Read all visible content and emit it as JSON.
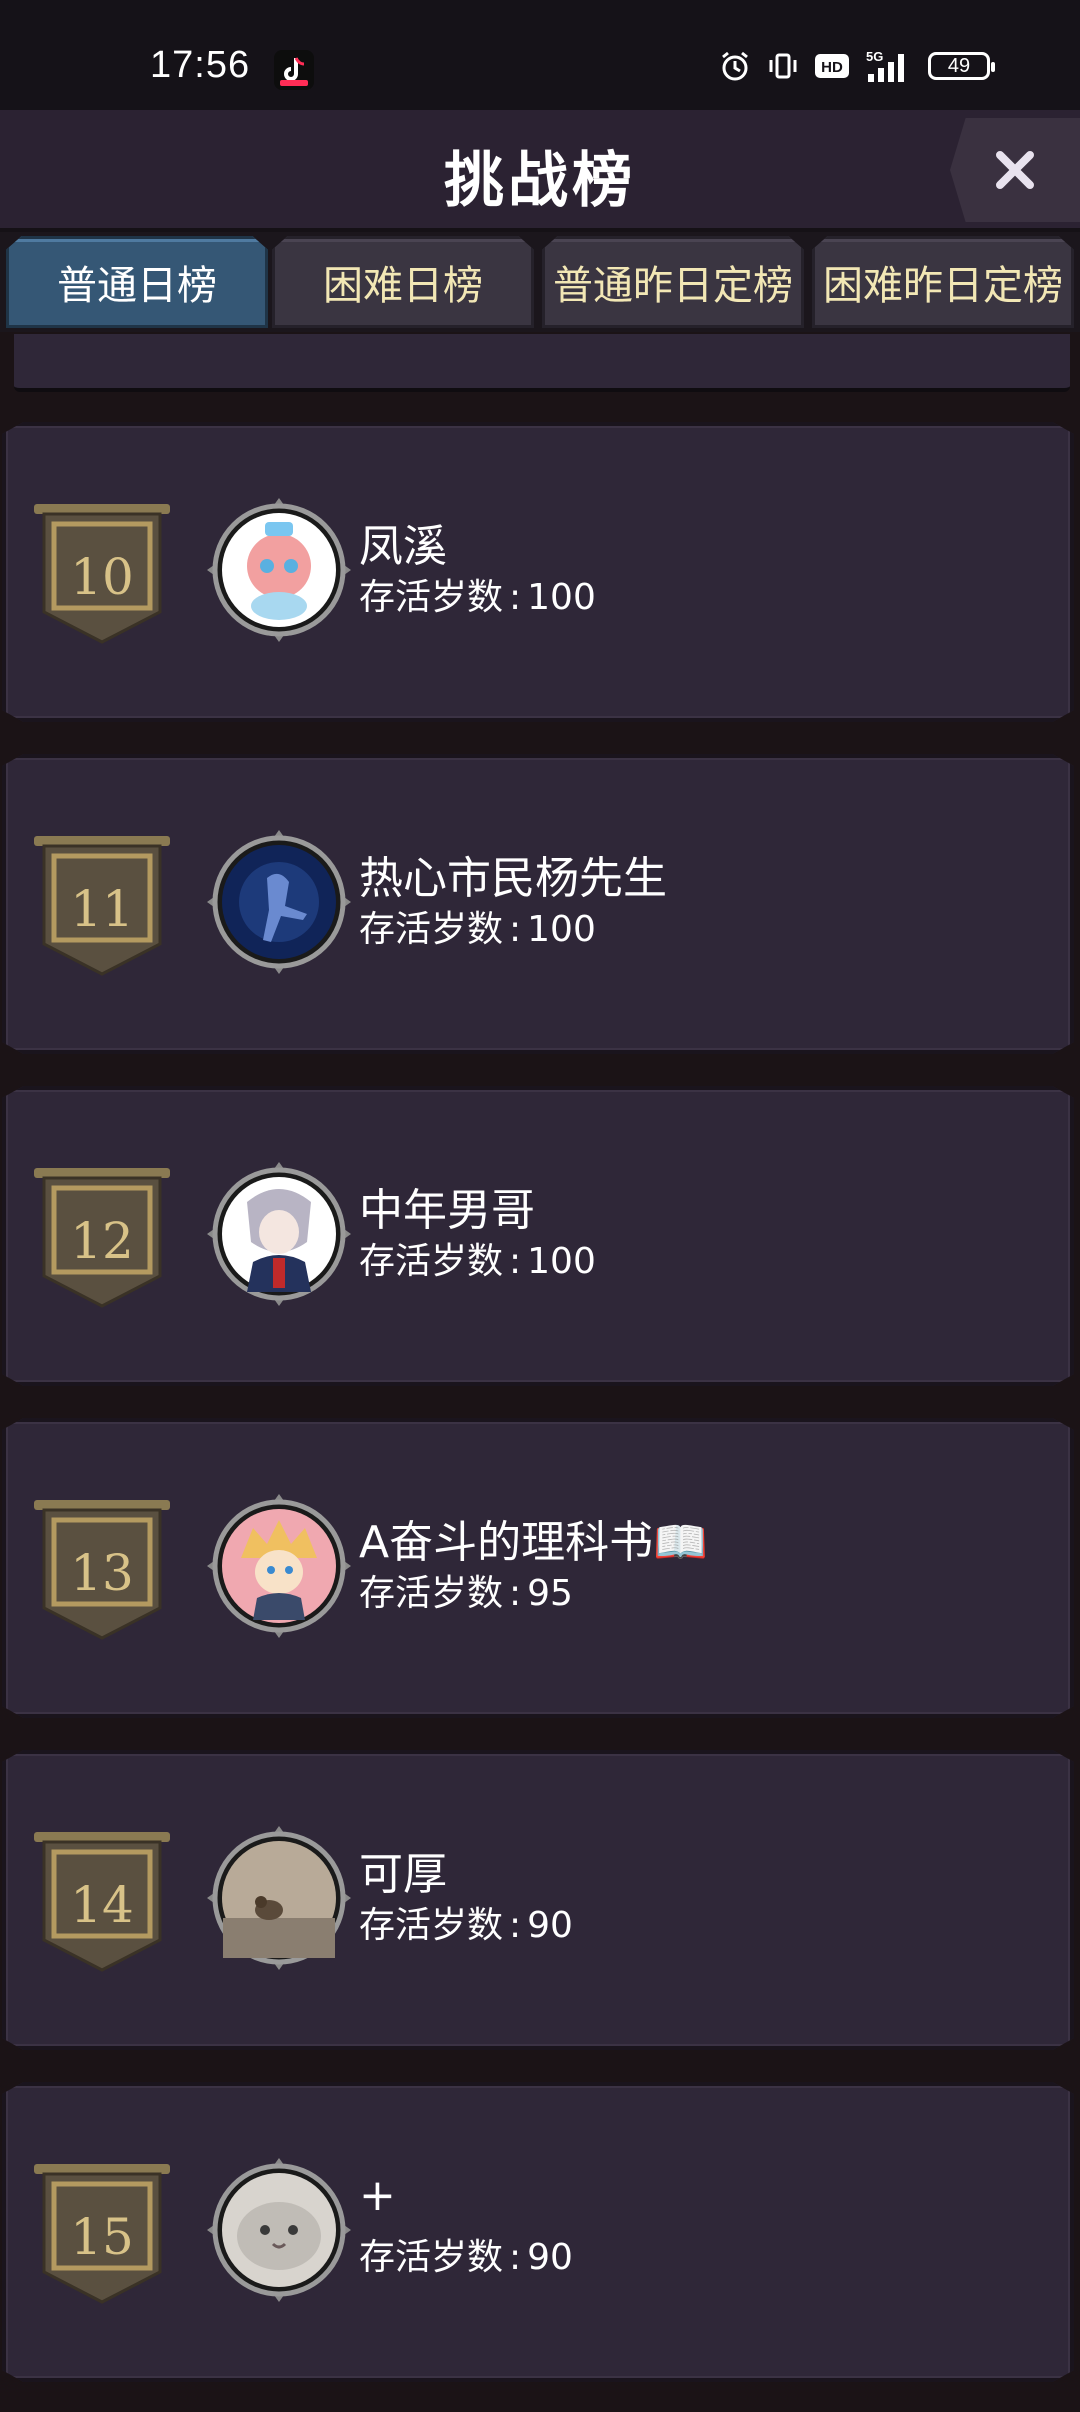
{
  "status_bar": {
    "time": "17:56",
    "network": "5G",
    "hd_label": "HD",
    "battery": "49"
  },
  "header": {
    "title": "挑战榜",
    "close_icon": "close-icon"
  },
  "tabs": [
    {
      "label": "普通日榜",
      "active": true
    },
    {
      "label": "困难日榜",
      "active": false
    },
    {
      "label": "普通昨日定榜",
      "active": false
    },
    {
      "label": "困难昨日定榜",
      "active": false
    }
  ],
  "score_label": "存活岁数",
  "entries": [
    {
      "rank": "10",
      "name": "凤溪",
      "score": "100",
      "avatar_color": "#f2a0a0"
    },
    {
      "rank": "11",
      "name": "热心市民杨先生",
      "score": "100",
      "avatar_color": "#1d3a7a"
    },
    {
      "rank": "12",
      "name": "中年男哥",
      "score": "100",
      "avatar_color": "#6a5c7a"
    },
    {
      "rank": "13",
      "name": "A奋斗的理科书📖",
      "score": "95",
      "avatar_color": "#f0c060"
    },
    {
      "rank": "14",
      "name": "可厚",
      "score": "90",
      "avatar_color": "#9a8e80"
    },
    {
      "rank": "15",
      "name": "+",
      "score": "90",
      "avatar_color": "#c0bcb6"
    }
  ],
  "colors": {
    "card_bg": "#2f2738",
    "active_tab": "#355775",
    "tab_text": "#f2e7b5",
    "rank_gold": "#d8c288"
  }
}
